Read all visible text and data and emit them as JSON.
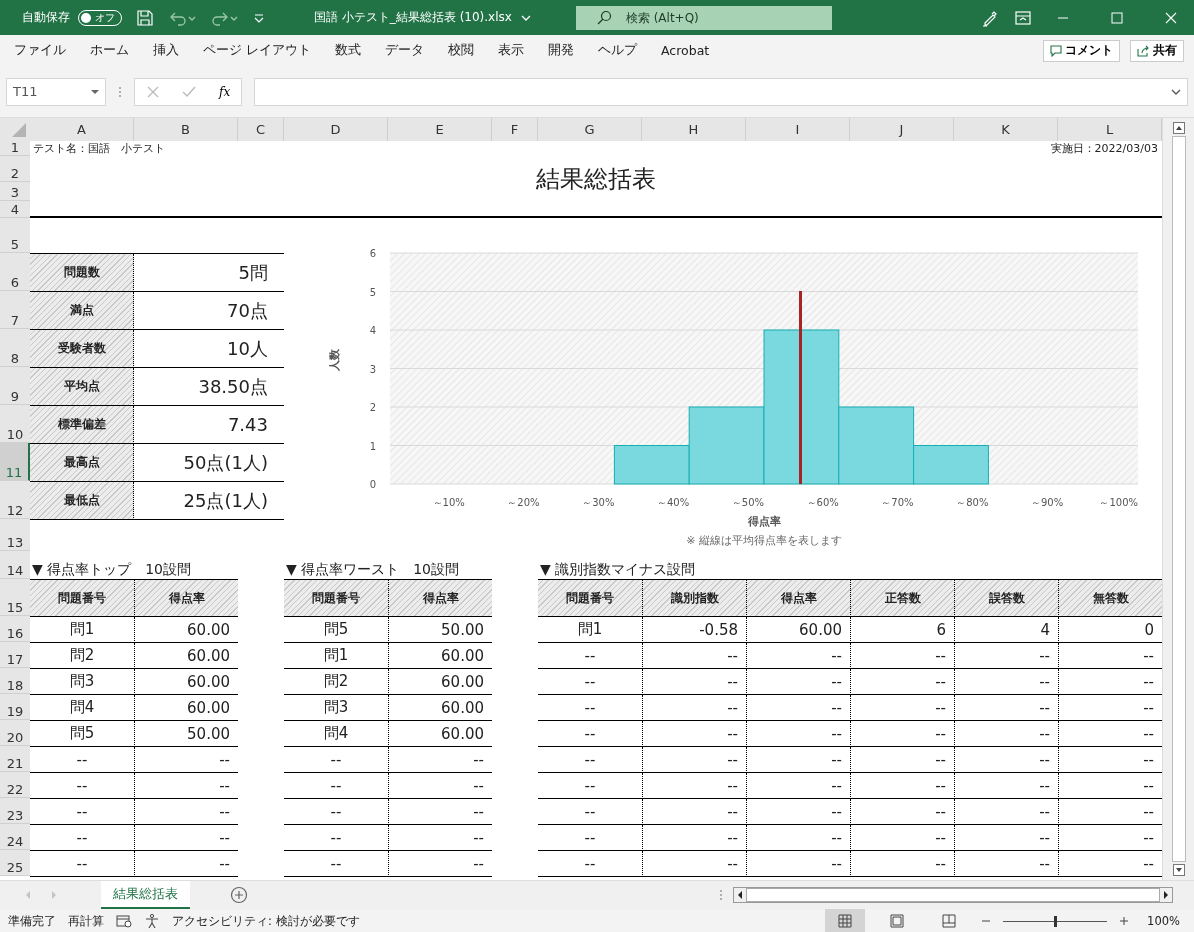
{
  "title_bar": {
    "autosave_label": "自動保存",
    "autosave_toggle": {
      "label": "オフ",
      "on": false
    },
    "filename": "国語  小テスト_結果総括表 (10).xlsx",
    "search": {
      "placeholder": "検索 (Alt+Q)"
    }
  },
  "ribbon": {
    "tabs": [
      "ファイル",
      "ホーム",
      "挿入",
      "ページ レイアウト",
      "数式",
      "データ",
      "校閲",
      "表示",
      "開発",
      "ヘルプ",
      "Acrobat"
    ],
    "comment_button": "コメント",
    "share_button": "共有"
  },
  "formula_bar": {
    "name_box": "T11",
    "fx_label": "fx"
  },
  "column_headers": [
    "A",
    "B",
    "C",
    "D",
    "E",
    "F",
    "G",
    "H",
    "I",
    "J",
    "K",
    "L"
  ],
  "row_headers": [
    {
      "label": "1",
      "selected": false
    },
    {
      "label": "2",
      "selected": false
    },
    {
      "label": "3",
      "selected": false
    },
    {
      "label": "4",
      "selected": false
    },
    {
      "label": "5",
      "selected": false
    },
    {
      "label": "6",
      "selected": false
    },
    {
      "label": "7",
      "selected": false
    },
    {
      "label": "8",
      "selected": false
    },
    {
      "label": "9",
      "selected": false
    },
    {
      "label": "10",
      "selected": false
    },
    {
      "label": "11",
      "selected": true
    },
    {
      "label": "12",
      "selected": false
    },
    {
      "label": "13",
      "selected": false
    },
    {
      "label": "14",
      "selected": false
    },
    {
      "label": "15",
      "selected": false
    },
    {
      "label": "16",
      "selected": false
    },
    {
      "label": "17",
      "selected": false
    },
    {
      "label": "18",
      "selected": false
    },
    {
      "label": "19",
      "selected": false
    },
    {
      "label": "20",
      "selected": false
    },
    {
      "label": "21",
      "selected": false
    },
    {
      "label": "22",
      "selected": false
    },
    {
      "label": "23",
      "selected": false
    },
    {
      "label": "24",
      "selected": false
    },
    {
      "label": "25",
      "selected": false
    }
  ],
  "sheet": {
    "test_name": "テスト名：国語　小テスト",
    "date": "実施日：2022/03/03",
    "title": "結果総括表",
    "stats": [
      {
        "label": "問題数",
        "value": "5問"
      },
      {
        "label": "満点",
        "value": "70点"
      },
      {
        "label": "受験者数",
        "value": "10人"
      },
      {
        "label": "平均点",
        "value": "38.50点"
      },
      {
        "label": "標準偏差",
        "value": "7.43"
      },
      {
        "label": "最高点",
        "value": "50点(1人)"
      },
      {
        "label": "最低点",
        "value": "25点(1人)"
      }
    ],
    "chart": {
      "note": "※ 縦線は平均得点率を表します",
      "chart_data": {
        "type": "bar",
        "xlabel": "得点率",
        "ylabel": "人数",
        "categories": [
          "～10%",
          "～20%",
          "～30%",
          "～40%",
          "～50%",
          "～60%",
          "～70%",
          "～80%",
          "～90%",
          "～100%"
        ],
        "series": [
          {
            "color": "#7ad9de",
            "values": [
              0,
              0,
              0,
              1,
              2,
              4,
              2,
              1,
              0,
              0
            ]
          }
        ],
        "ylim": [
          0,
          6
        ],
        "yticks": [
          0,
          1,
          2,
          3,
          4,
          5,
          6
        ],
        "grid": true
      }
    },
    "tables": [
      {
        "heading": "▼ 得点率トップ　10設問",
        "columns": [
          "問題番号",
          "得点率"
        ],
        "rows": [
          [
            "問1",
            "60.00"
          ],
          [
            "問2",
            "60.00"
          ],
          [
            "問3",
            "60.00"
          ],
          [
            "問4",
            "60.00"
          ],
          [
            "問5",
            "50.00"
          ],
          [
            "--",
            "--"
          ],
          [
            "--",
            "--"
          ],
          [
            "--",
            "--"
          ],
          [
            "--",
            "--"
          ],
          [
            "--",
            "--"
          ]
        ]
      },
      {
        "heading": "▼ 得点率ワースト　10設問",
        "columns": [
          "問題番号",
          "得点率"
        ],
        "rows": [
          [
            "問5",
            "50.00"
          ],
          [
            "問1",
            "60.00"
          ],
          [
            "問2",
            "60.00"
          ],
          [
            "問3",
            "60.00"
          ],
          [
            "問4",
            "60.00"
          ],
          [
            "--",
            "--"
          ],
          [
            "--",
            "--"
          ],
          [
            "--",
            "--"
          ],
          [
            "--",
            "--"
          ],
          [
            "--",
            "--"
          ]
        ]
      },
      {
        "heading": "▼ 識別指数マイナス設問",
        "columns": [
          "問題番号",
          "識別指数",
          "得点率",
          "正答数",
          "誤答数",
          "無答数"
        ],
        "rows": [
          [
            "問1",
            "-0.58",
            "60.00",
            "6",
            "4",
            "0"
          ],
          [
            "--",
            "--",
            "--",
            "--",
            "--",
            "--"
          ],
          [
            "--",
            "--",
            "--",
            "--",
            "--",
            "--"
          ],
          [
            "--",
            "--",
            "--",
            "--",
            "--",
            "--"
          ],
          [
            "--",
            "--",
            "--",
            "--",
            "--",
            "--"
          ],
          [
            "--",
            "--",
            "--",
            "--",
            "--",
            "--"
          ],
          [
            "--",
            "--",
            "--",
            "--",
            "--",
            "--"
          ],
          [
            "--",
            "--",
            "--",
            "--",
            "--",
            "--"
          ],
          [
            "--",
            "--",
            "--",
            "--",
            "--",
            "--"
          ],
          [
            "--",
            "--",
            "--",
            "--",
            "--",
            "--"
          ]
        ]
      }
    ]
  },
  "sheet_tabs": [
    {
      "label": "結果総括表",
      "selected": true
    }
  ],
  "status_bar": {
    "ready": "準備完了",
    "recalc": "再計算",
    "accessibility": "アクセシビリティ: 検討が必要です",
    "views": [
      {
        "kind": "normal",
        "selected": true
      },
      {
        "kind": "page",
        "selected": false
      },
      {
        "kind": "break",
        "selected": false
      }
    ],
    "zoom": {
      "level": 0.5,
      "reading": "100%"
    }
  }
}
